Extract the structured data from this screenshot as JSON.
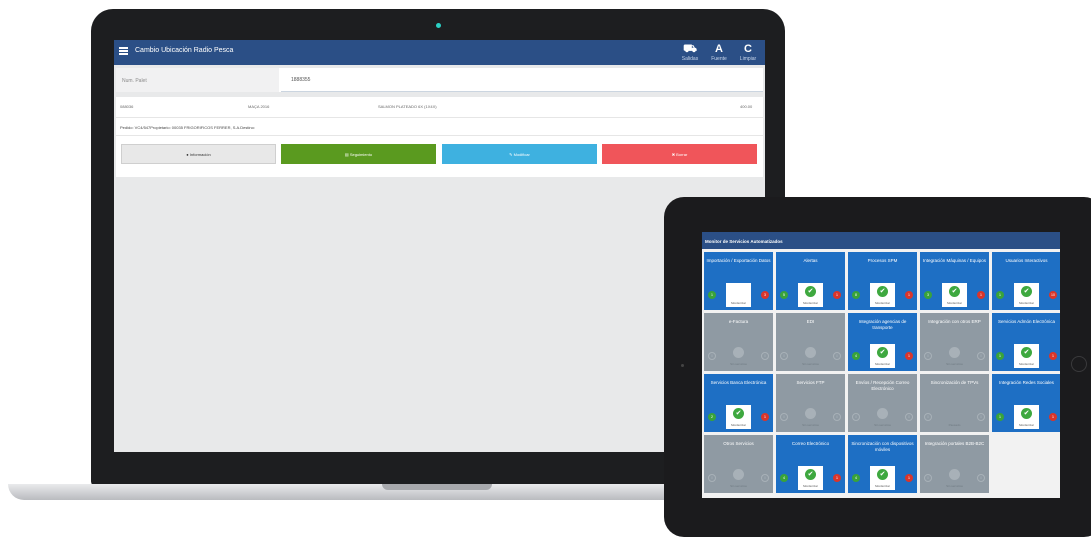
{
  "laptop": {
    "app_title": "Cambio Ubicación Radio Pesca",
    "header_buttons": [
      {
        "icon": "truck-icon",
        "glyph": "⛟",
        "label": "Salidas"
      },
      {
        "icon": "font-icon",
        "glyph": "A",
        "label": "Fuente"
      },
      {
        "icon": "refresh-icon",
        "glyph": "C",
        "label": "Limpiar"
      }
    ],
    "pallet": {
      "label": "Num. Palet",
      "value": "1888355"
    },
    "info": {
      "code": "088036",
      "date": "MAÇA 2016",
      "location": "SALMON PLATEADO 6X (1X4X)",
      "qty": "400.00",
      "order_line": "Pedido: VC4/547Propietario: 00035 FRIGORIFICOS FERRER, S.A.Destino:"
    },
    "actions": [
      {
        "label": "Información",
        "color": "#e8e8e8",
        "text_color": "#333333",
        "icon": "info-icon"
      },
      {
        "label": "Seguimiento",
        "color": "#5a9a1f",
        "text_color": "#ffffff",
        "icon": "list-icon"
      },
      {
        "label": "Modificar",
        "color": "#3eb1e0",
        "text_color": "#ffffff",
        "icon": "edit-icon"
      },
      {
        "label": "Borrar",
        "color": "#f0555a",
        "text_color": "#ffffff",
        "icon": "trash-icon"
      }
    ]
  },
  "tablet": {
    "title": "Monitor de Servicios Automatizados",
    "tiles": [
      {
        "title": "Importación / Exportación Datos",
        "state": "active",
        "label": "Monitorizar",
        "left": "1",
        "right": "3",
        "check": false
      },
      {
        "title": "Alertas",
        "state": "active",
        "label": "Monitorizar",
        "left": "5",
        "right": "1",
        "check": true
      },
      {
        "title": "Procesos SPM",
        "state": "active",
        "label": "Monitorizar",
        "left": "8",
        "right": "1",
        "check": true
      },
      {
        "title": "Integración Máquinas / Equipos",
        "state": "active",
        "label": "Monitorizar",
        "left": "3",
        "right": "1",
        "check": true
      },
      {
        "title": "Usuarios Interactivos",
        "state": "active",
        "label": "Monitorizar",
        "left": "1",
        "right": "10",
        "check": true
      },
      {
        "title": "e-Factura",
        "state": "inactive",
        "label": "Sin servicios",
        "left": "0",
        "right": "0",
        "check": true
      },
      {
        "title": "EDI",
        "state": "inactive",
        "label": "Sin servicios",
        "left": "0",
        "right": "0",
        "check": true
      },
      {
        "title": "Integración agencias de transporte",
        "state": "active",
        "label": "Monitorizar",
        "left": "4",
        "right": "1",
        "check": true
      },
      {
        "title": "Integración con otros ERP",
        "state": "inactive",
        "label": "Sin servicios",
        "left": "0",
        "right": "0",
        "check": true
      },
      {
        "title": "Servicios Admón Electrónica",
        "state": "active",
        "label": "Monitorizar",
        "left": "1",
        "right": "1",
        "check": true
      },
      {
        "title": "Servicios Banca Electrónica",
        "state": "active",
        "label": "Monitorizar",
        "left": "2",
        "right": "1",
        "check": true
      },
      {
        "title": "Servicios FTP",
        "state": "inactive",
        "label": "Sin servicios",
        "left": "0",
        "right": "0",
        "check": true
      },
      {
        "title": "Envíos / Recepción Correo Electrónico",
        "state": "inactive",
        "label": "Sin servicios",
        "left": "0",
        "right": "0",
        "check": true
      },
      {
        "title": "Sincronización de TPVs",
        "state": "inactive",
        "label": "Pausado",
        "left": "0",
        "right": "0",
        "check": false
      },
      {
        "title": "Integración Redes Sociales",
        "state": "active",
        "label": "Monitorizar",
        "left": "1",
        "right": "1",
        "check": true
      },
      {
        "title": "Otros Servicios",
        "state": "inactive",
        "label": "Sin servicios",
        "left": "0",
        "right": "0",
        "check": true
      },
      {
        "title": "Correo Electrónico",
        "state": "active",
        "label": "Monitorizar",
        "left": "4",
        "right": "1",
        "check": true
      },
      {
        "title": "Sincronización con dispositivos móviles",
        "state": "active",
        "label": "Monitorizar",
        "left": "4",
        "right": "1",
        "check": true
      },
      {
        "title": "Integración portales B2B-B2C",
        "state": "inactive",
        "label": "Sin servicios",
        "left": "0",
        "right": "0",
        "check": true
      }
    ]
  }
}
